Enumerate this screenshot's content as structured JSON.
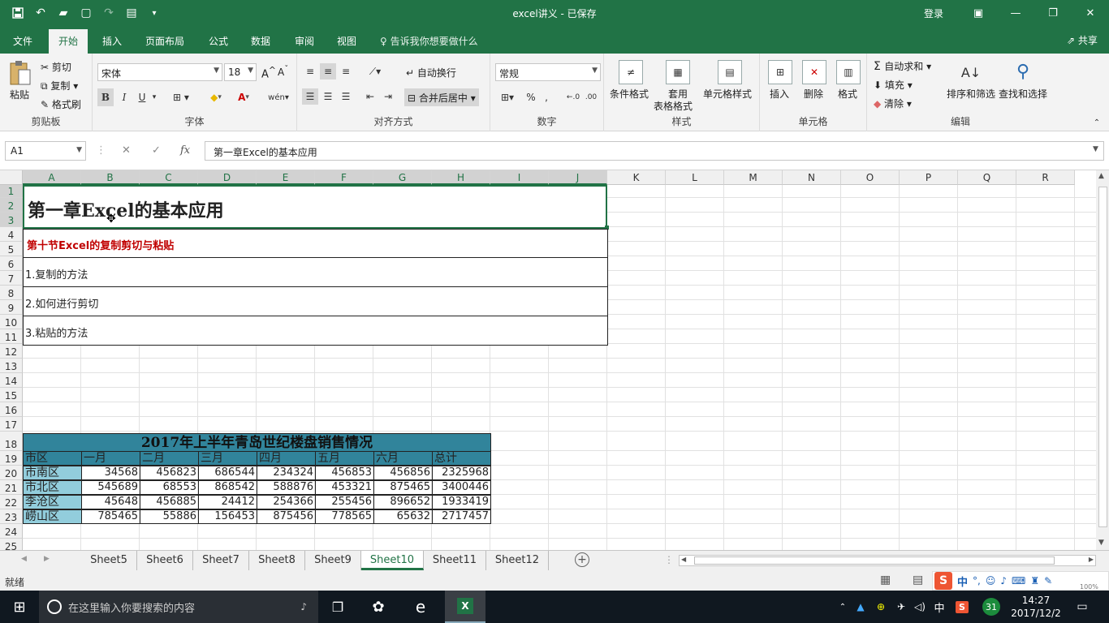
{
  "window": {
    "title": "excel讲义 - 已保存",
    "login": "登录",
    "share": "共享"
  },
  "qat": {
    "save_icon": "save-icon",
    "undo_icon": "undo-icon",
    "open_icon": "open-icon",
    "new_icon": "new-icon",
    "redo_icon": "redo-icon",
    "paste_icon": "paste-icon",
    "more_icon": "customize-icon"
  },
  "tabs": [
    "文件",
    "开始",
    "插入",
    "页面布局",
    "公式",
    "数据",
    "审阅",
    "视图"
  ],
  "tellme": "告诉我你想要做什么",
  "ribbon": {
    "clipboard": {
      "label": "剪贴板",
      "paste": "粘贴",
      "cut": "剪切",
      "copy": "复制",
      "painter": "格式刷"
    },
    "font": {
      "label": "字体",
      "name": "宋体",
      "size": "18",
      "bold": "B",
      "italic": "I",
      "underline": "U",
      "phonetic": "wén"
    },
    "align": {
      "label": "对齐方式",
      "wrap": "自动换行",
      "merge": "合并后居中"
    },
    "number": {
      "label": "数字",
      "format": "常规",
      "percent": "%",
      "comma": ","
    },
    "styles": {
      "label": "样式",
      "cond": "条件格式",
      "table1": "套用",
      "table2": "表格格式",
      "cell": "单元格样式"
    },
    "cells": {
      "label": "单元格",
      "insert": "插入",
      "delete": "删除",
      "format": "格式"
    },
    "editing": {
      "label": "编辑",
      "autosum": "自动求和",
      "fill": "填充",
      "clear": "清除",
      "sort": "排序和筛选",
      "find": "查找和选择"
    }
  },
  "formula": {
    "namebox": "A1",
    "fx": "fx",
    "content": "第一章Excel的基本应用"
  },
  "columns": [
    "A",
    "B",
    "C",
    "D",
    "E",
    "F",
    "G",
    "H",
    "I",
    "J",
    "K",
    "L",
    "M",
    "N",
    "O",
    "P",
    "Q",
    "R"
  ],
  "rows": [
    "1",
    "2",
    "3",
    "4",
    "5",
    "6",
    "7",
    "8",
    "9",
    "10",
    "11",
    "12",
    "13",
    "14",
    "15",
    "16",
    "17",
    "18",
    "19",
    "20",
    "21",
    "22",
    "23",
    "24",
    "25"
  ],
  "cells": {
    "chapter": "第一章Excel的基本应用",
    "section": "第十节Excel的复制剪切与粘贴",
    "item1": "1.复制的方法",
    "item2": "2.如何进行剪切",
    "item3": "3.粘贴的方法"
  },
  "table": {
    "title": "2017年上半年青岛世纪楼盘销售情况",
    "headers": [
      "市区",
      "一月",
      "二月",
      "三月",
      "四月",
      "五月",
      "六月",
      "总计"
    ],
    "rows": [
      [
        "市南区",
        "34568",
        "456823",
        "686544",
        "234324",
        "456853",
        "456856",
        "2325968"
      ],
      [
        "市北区",
        "545689",
        "68553",
        "868542",
        "588876",
        "453321",
        "875465",
        "3400446"
      ],
      [
        "李沧区",
        "45648",
        "456885",
        "24412",
        "254366",
        "255456",
        "896652",
        "1933419"
      ],
      [
        "崂山区",
        "785465",
        "55886",
        "156453",
        "875456",
        "778565",
        "65632",
        "2717457"
      ]
    ],
    "colors": {
      "title_bg": "#31849b",
      "header_bg": "#31849b",
      "district_bg": "#92cddc"
    }
  },
  "sheets": [
    "Sheet5",
    "Sheet6",
    "Sheet7",
    "Sheet8",
    "Sheet9",
    "Sheet10",
    "Sheet11",
    "Sheet12"
  ],
  "active_sheet": "Sheet10",
  "status": {
    "ready": "就绪",
    "zoom": "100%"
  },
  "taskbar": {
    "search_placeholder": "在这里输入你要搜索的内容",
    "time": "14:27",
    "date": "2017/12/2",
    "ime": "中",
    "badge": "31"
  },
  "colors": {
    "accent": "#217346"
  }
}
